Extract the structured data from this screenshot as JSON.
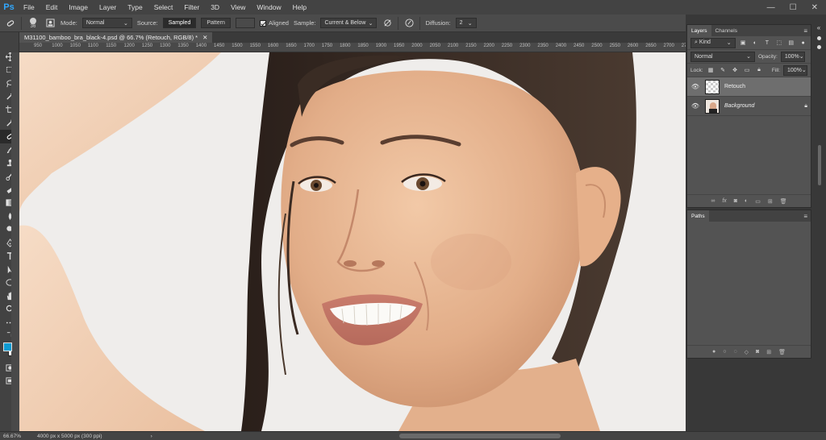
{
  "app": {
    "logo": "Ps"
  },
  "menu": [
    "File",
    "Edit",
    "Image",
    "Layer",
    "Type",
    "Select",
    "Filter",
    "3D",
    "View",
    "Window",
    "Help"
  ],
  "window_controls": {
    "minimize": "—",
    "restore": "☐",
    "close": "✕"
  },
  "options": {
    "brush_size": "36",
    "mode_label": "Mode:",
    "mode_value": "Normal",
    "source_label": "Source:",
    "source_sampled": "Sampled",
    "source_pattern": "Pattern",
    "aligned_label": "Aligned",
    "sample_label": "Sample:",
    "sample_value": "Current & Below",
    "diffusion_label": "Diffusion:",
    "diffusion_value": "2"
  },
  "document": {
    "tab_title": "M31100_bamboo_bra_black-4.psd @ 66.7% (Retouch, RGB/8) *",
    "close": "✕"
  },
  "ruler": [
    "950",
    "1000",
    "1050",
    "1100",
    "1150",
    "1200",
    "1250",
    "1300",
    "1350",
    "1400",
    "1450",
    "1500",
    "1550",
    "1600",
    "1650",
    "1700",
    "1750",
    "1800",
    "1850",
    "1900",
    "1950",
    "2000",
    "2050",
    "2100",
    "2150",
    "2200",
    "2250",
    "2300",
    "2350",
    "2400",
    "2450",
    "2500",
    "2550",
    "2600",
    "2650",
    "2700",
    "2750"
  ],
  "status": {
    "zoom": "66.67%",
    "doc_info": "4000 px x 5000 px (300 ppi)",
    "arrow": "›"
  },
  "layers_panel": {
    "tabs": [
      "Layers",
      "Channels"
    ],
    "kind_label": "Kind",
    "blend_mode": "Normal",
    "opacity_label": "Opacity:",
    "opacity_value": "100%",
    "lock_label": "Lock:",
    "fill_label": "Fill:",
    "fill_value": "100%",
    "layers": [
      {
        "name": "Retouch",
        "selected": true
      },
      {
        "name": "Background",
        "selected": false
      }
    ]
  },
  "paths_panel": {
    "title": "Paths"
  },
  "colors": {
    "accent": "#31a8ff",
    "foreground": "#0e9bd2",
    "background": "#ffffff"
  }
}
